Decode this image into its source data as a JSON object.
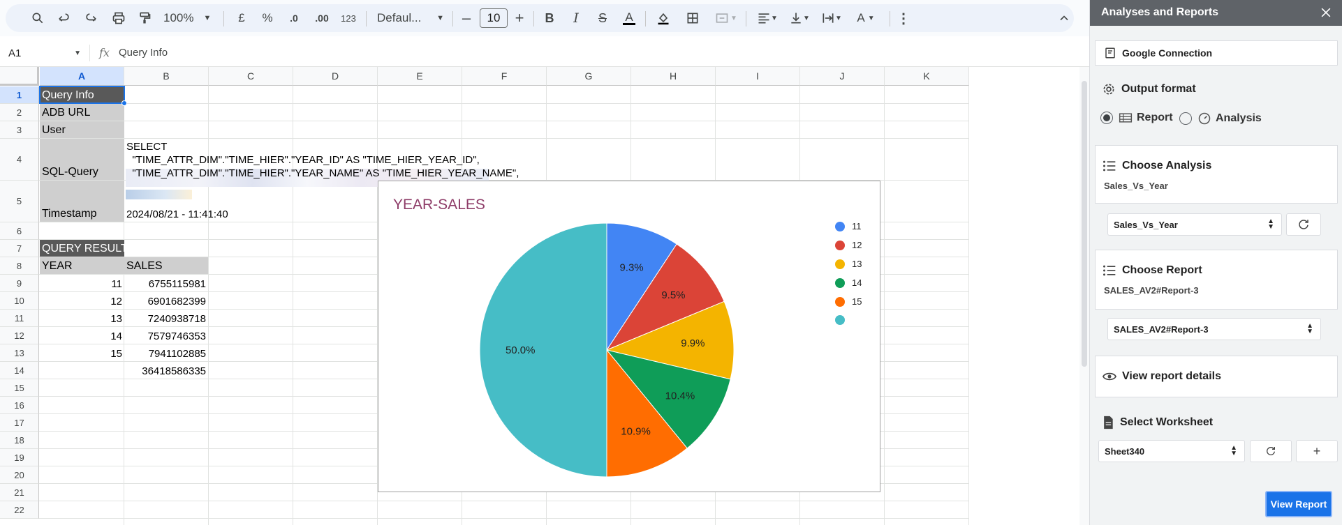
{
  "toolbar": {
    "zoom": "100%",
    "currency": "£",
    "percent": "%",
    "dec_decrease": ".0",
    "dec_increase": ".00",
    "number_format": "123",
    "font": "Defaul...",
    "font_size": "10"
  },
  "formula_bar": {
    "cell_ref": "A1",
    "fx": "fx",
    "content": "Query Info"
  },
  "grid": {
    "columns": [
      "A",
      "B",
      "C",
      "D",
      "E",
      "F",
      "G",
      "H",
      "I",
      "J",
      "K"
    ],
    "rows": [
      "1",
      "2",
      "3",
      "4",
      "5",
      "6",
      "7",
      "8",
      "9",
      "10",
      "11",
      "12",
      "13",
      "14",
      "15",
      "16",
      "17",
      "18",
      "19",
      "20",
      "21",
      "22"
    ],
    "labels": {
      "query_info": "Query Info",
      "adb_url": "ADB URL",
      "user": "User",
      "sql_query": "SQL-Query",
      "timestamp": "Timestamp",
      "query_result": "QUERY RESULT",
      "year_header": "YEAR",
      "sales_header": "SALES"
    },
    "sql_lines": [
      "SELECT",
      "  \"TIME_ATTR_DIM\".\"TIME_HIER\".\"YEAR_ID\" AS \"TIME_HIER_YEAR_ID\",",
      "  \"TIME_ATTR_DIM\".\"TIME_HIER\".\"YEAR_NAME\" AS \"TIME_HIER_YEAR_NAME\","
    ],
    "timestamp_value": "2024/08/21 - 11:41:40",
    "result_rows": [
      {
        "year": "11",
        "sales": "6755115981"
      },
      {
        "year": "12",
        "sales": "6901682399"
      },
      {
        "year": "13",
        "sales": "7240938718"
      },
      {
        "year": "14",
        "sales": "7579746353"
      },
      {
        "year": "15",
        "sales": "7941102885"
      },
      {
        "year": "",
        "sales": "36418586335"
      }
    ]
  },
  "chart_data": {
    "type": "pie",
    "title": "YEAR-SALES",
    "categories": [
      "11",
      "12",
      "13",
      "14",
      "15",
      ""
    ],
    "values": [
      6755115981,
      6901682399,
      7240938718,
      7579746353,
      7941102885,
      36418586335
    ],
    "labels": [
      "9.3%",
      "9.5%",
      "9.9%",
      "10.4%",
      "10.9%",
      "50.0%"
    ],
    "colors": [
      "#4285f4",
      "#db4437",
      "#f4b400",
      "#0f9d58",
      "#ff6d01",
      "#46bdc6"
    ],
    "legend_position": "right"
  },
  "panel": {
    "title": "Analyses and Reports",
    "connection_label": "Google Connection",
    "output_format_title": "Output format",
    "radio_report": "Report",
    "radio_analysis": "Analysis",
    "choose_analysis_title": "Choose Analysis",
    "choose_analysis_current": "Sales_Vs_Year",
    "analysis_select_value": "Sales_Vs_Year",
    "choose_report_title": "Choose Report",
    "choose_report_current": "SALES_AV2#Report-3",
    "report_select_value": "SALES_AV2#Report-3",
    "view_details_label": "View report details",
    "select_worksheet_title": "Select Worksheet",
    "worksheet_value": "Sheet340",
    "add_label": "+",
    "view_report_label": "View Report"
  }
}
